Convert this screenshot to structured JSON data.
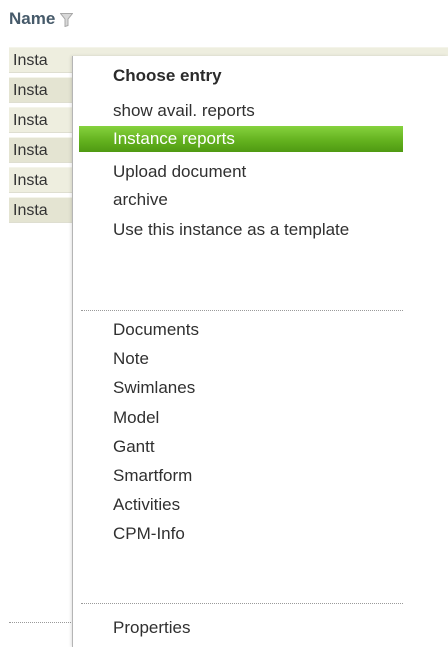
{
  "table": {
    "column_name": "Name",
    "filter_icon": "filter-icon",
    "rows": [
      "Insta",
      "Insta",
      "Insta",
      "Insta",
      "Insta",
      "Insta"
    ]
  },
  "menu": {
    "title": "Choose entry",
    "group1": [
      {
        "label": "show avail. reports"
      },
      {
        "label": "Instance reports",
        "selected": true
      },
      {
        "label": "Upload document"
      },
      {
        "label": "archive"
      },
      {
        "label": "Use this instance as a template"
      }
    ],
    "group2": [
      {
        "label": "Documents"
      },
      {
        "label": "Note"
      },
      {
        "label": "Swimlanes"
      },
      {
        "label": "Model"
      },
      {
        "label": "Gantt"
      },
      {
        "label": "Smartform"
      },
      {
        "label": "Activities"
      },
      {
        "label": "CPM-Info"
      }
    ],
    "group3": [
      {
        "label": "Properties"
      }
    ],
    "highlight_color": "#64b21f"
  }
}
